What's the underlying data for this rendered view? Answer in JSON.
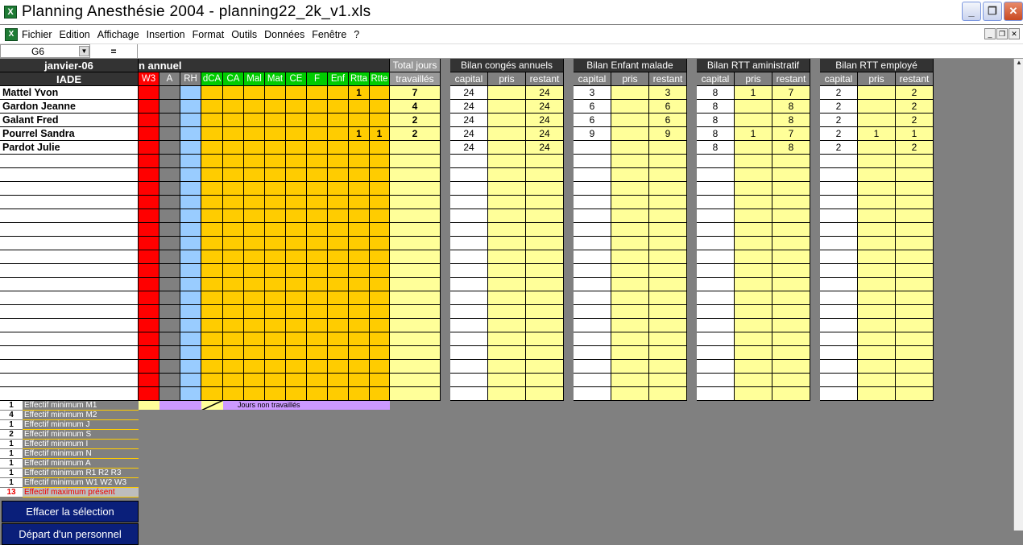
{
  "window": {
    "title": "Planning Anesthésie 2004 - planning22_2k_v1.xls",
    "excel_icon": "excel-icon"
  },
  "menu": [
    "Fichier",
    "Edition",
    "Affichage",
    "Insertion",
    "Format",
    "Outils",
    "Données",
    "Fenêtre",
    "?"
  ],
  "formula": {
    "cell_ref": "G6",
    "eq": "="
  },
  "header": {
    "month": "janvier-06",
    "group": "IADE",
    "title_partial": "n annuel",
    "total_days_line1": "Total jours",
    "total_days_line2": "travaillés"
  },
  "codes": [
    "W3",
    "A",
    "RH",
    "dCA",
    "CA",
    "Mal",
    "Mat",
    "CE",
    "F",
    "Enf",
    "Rtta",
    "Rtte"
  ],
  "code_colors": {
    "W3": "#ff0000",
    "A": "#808080",
    "RH": "#99ccff",
    "dCA": "#ffcc00",
    "CA": "#ffcc00",
    "Mal": "#ffcc00",
    "Mat": "#ffcc00",
    "CE": "#ffcc00",
    "F": "#ffcc00",
    "Enf": "#ffcc00",
    "Rtta": "#ffcc00",
    "Rtte": "#ffcc00",
    "total": "#ffff99"
  },
  "bilans": [
    {
      "title": "Bilan congés annuels",
      "cols": [
        "capital",
        "pris",
        "restant"
      ]
    },
    {
      "title": "Bilan Enfant malade",
      "cols": [
        "capital",
        "pris",
        "restant"
      ]
    },
    {
      "title": "Bilan RTT aministratif",
      "cols": [
        "capital",
        "pris",
        "restant"
      ]
    },
    {
      "title": "Bilan RTT employé",
      "cols": [
        "capital",
        "pris",
        "restant"
      ]
    }
  ],
  "rows": [
    {
      "name": "Mattel Yvon",
      "rtta": "1",
      "rtte": "",
      "total": "7",
      "b": [
        [
          "24",
          "",
          "24"
        ],
        [
          "3",
          "",
          "3"
        ],
        [
          "8",
          "1",
          "7"
        ],
        [
          "2",
          "",
          "2"
        ]
      ]
    },
    {
      "name": "Gardon Jeanne",
      "rtta": "",
      "rtte": "",
      "total": "4",
      "b": [
        [
          "24",
          "",
          "24"
        ],
        [
          "6",
          "",
          "6"
        ],
        [
          "8",
          "",
          "8"
        ],
        [
          "2",
          "",
          "2"
        ]
      ]
    },
    {
      "name": "Galant Fred",
      "rtta": "",
      "rtte": "",
      "total": "2",
      "b": [
        [
          "24",
          "",
          "24"
        ],
        [
          "6",
          "",
          "6"
        ],
        [
          "8",
          "",
          "8"
        ],
        [
          "2",
          "",
          "2"
        ]
      ]
    },
    {
      "name": "Pourrel Sandra",
      "rtta": "1",
      "rtte": "1",
      "total": "2",
      "b": [
        [
          "24",
          "",
          "24"
        ],
        [
          "9",
          "",
          "9"
        ],
        [
          "8",
          "1",
          "7"
        ],
        [
          "2",
          "1",
          "1"
        ]
      ]
    },
    {
      "name": "Pardot Julie",
      "rtta": "",
      "rtte": "",
      "total": "",
      "b": [
        [
          "24",
          "",
          "24"
        ],
        [
          "",
          "",
          ""
        ],
        [
          "8",
          "",
          "8"
        ],
        [
          "2",
          "",
          "2"
        ]
      ]
    }
  ],
  "legend": {
    "jours_non_travailles": "Jours non travaillés"
  },
  "effectifs": [
    {
      "n": "1",
      "label": "Effectif minimum M1"
    },
    {
      "n": "4",
      "label": "Effectif minimum M2"
    },
    {
      "n": "1",
      "label": "Effectif minimum J"
    },
    {
      "n": "2",
      "label": "Effectif minimum S"
    },
    {
      "n": "1",
      "label": "Effectif minimum I"
    },
    {
      "n": "1",
      "label": "Effectif minimum N"
    },
    {
      "n": "1",
      "label": "Effectif minimum A"
    },
    {
      "n": "1",
      "label": "Effectif minimum R1 R2 R3"
    },
    {
      "n": "1",
      "label": "Effectif minimum W1 W2 W3"
    },
    {
      "n": "13",
      "label": "Effectif maximum présent"
    }
  ],
  "buttons": {
    "clear": "Effacer la sélection",
    "depart": "Départ d'un personnel"
  }
}
